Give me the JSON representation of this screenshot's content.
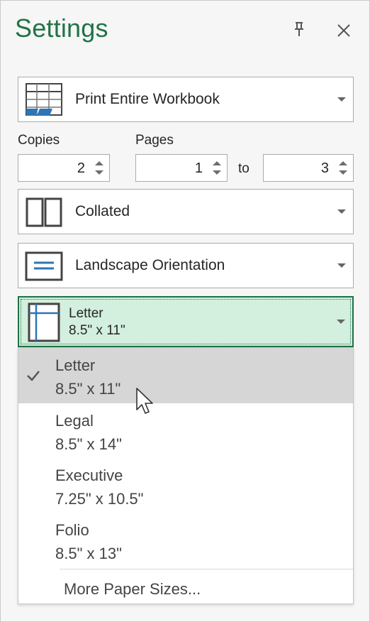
{
  "title": "Settings",
  "print_what": {
    "label": "Print Entire Workbook"
  },
  "copies": {
    "label": "Copies",
    "value": "2"
  },
  "pages": {
    "label": "Pages",
    "from": "1",
    "to_label": "to",
    "to": "3"
  },
  "collation": {
    "label": "Collated"
  },
  "orientation": {
    "label": "Landscape Orientation"
  },
  "paper_size": {
    "selected_name": "Letter",
    "selected_dims": "8.5\" x 11\"",
    "options": [
      {
        "name": "Letter",
        "dims": "8.5\" x 11\"",
        "selected": true
      },
      {
        "name": "Legal",
        "dims": "8.5\" x 14\""
      },
      {
        "name": "Executive",
        "dims": "7.25\" x 10.5\""
      },
      {
        "name": "Folio",
        "dims": "8.5\" x 13\""
      }
    ],
    "more_label": "More Paper Sizes..."
  },
  "colors": {
    "title_green": "#217346",
    "selected_combo_bg": "#d3efde",
    "accent_blue": "#2e75b6"
  }
}
